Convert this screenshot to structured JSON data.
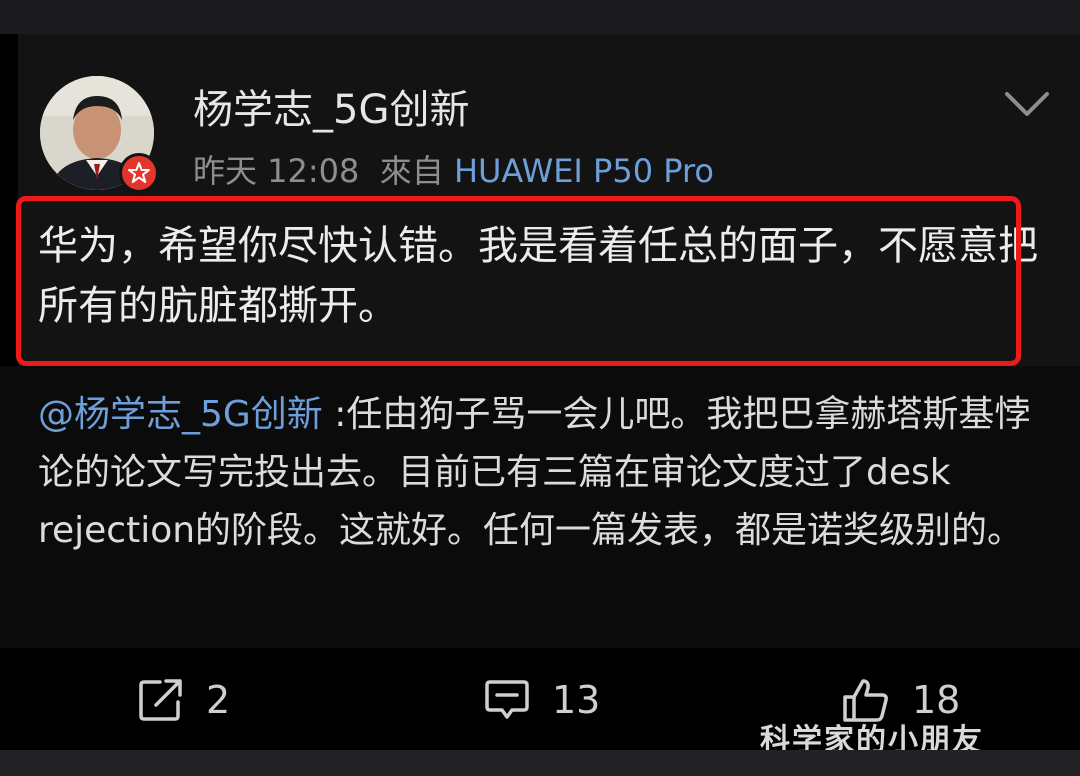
{
  "post": {
    "username": "杨学志_5G创新",
    "time": "昨天 12:08",
    "source_prefix": "來自",
    "device": "HUAWEI P50 Pro",
    "text": "华为，希望你尽快认错。我是看着任总的面子，不愿意把所有的肮脏都撕开。"
  },
  "repost": {
    "mention": "@杨学志_5G创新",
    "text": " :任由狗子骂一会儿吧。我把巴拿赫塔斯基悖论的论文写完投出去。目前已有三篇在审论文度过了desk rejection的阶段。这就好。任何一篇发表，都是诺奖级别的。"
  },
  "actions": {
    "repost_count": "2",
    "comment_count": "13",
    "like_count": "18"
  },
  "watermark": "科学家的小朋友"
}
